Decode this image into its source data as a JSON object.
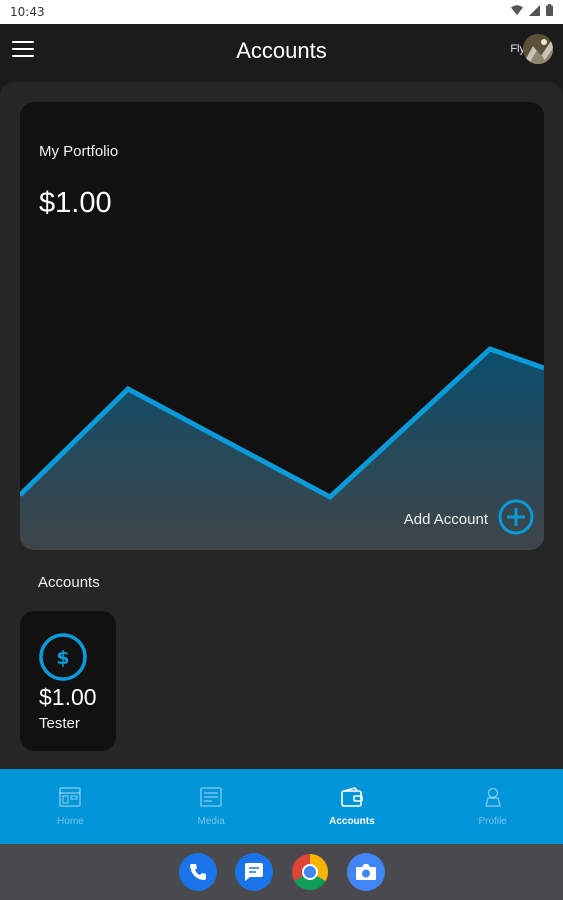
{
  "status_bar": {
    "time": "10:43",
    "icons": [
      "wifi-icon",
      "signal-icon",
      "battery-icon"
    ]
  },
  "header": {
    "title": "Accounts",
    "user_name": "Fly",
    "menu_icon": "hamburger-menu-icon"
  },
  "portfolio": {
    "label": "My Portfolio",
    "value": "$1.00",
    "add_account_label": "Add Account",
    "accent_color": "#0a9ad9"
  },
  "accounts_section": {
    "heading": "Accounts",
    "items": [
      {
        "amount": "$1.00",
        "name": "Tester",
        "icon": "dollar-coin-icon"
      }
    ]
  },
  "bottom_nav": {
    "items": [
      {
        "label": "Home",
        "icon": "home-icon",
        "active": false
      },
      {
        "label": "Media",
        "icon": "media-icon",
        "active": false
      },
      {
        "label": "Accounts",
        "icon": "wallet-icon",
        "active": true
      },
      {
        "label": "Profile",
        "icon": "profile-icon",
        "active": false
      }
    ],
    "background": "#0094d8"
  },
  "dock": {
    "apps": [
      "phone-icon",
      "messages-icon",
      "chrome-icon",
      "camera-icon"
    ]
  }
}
